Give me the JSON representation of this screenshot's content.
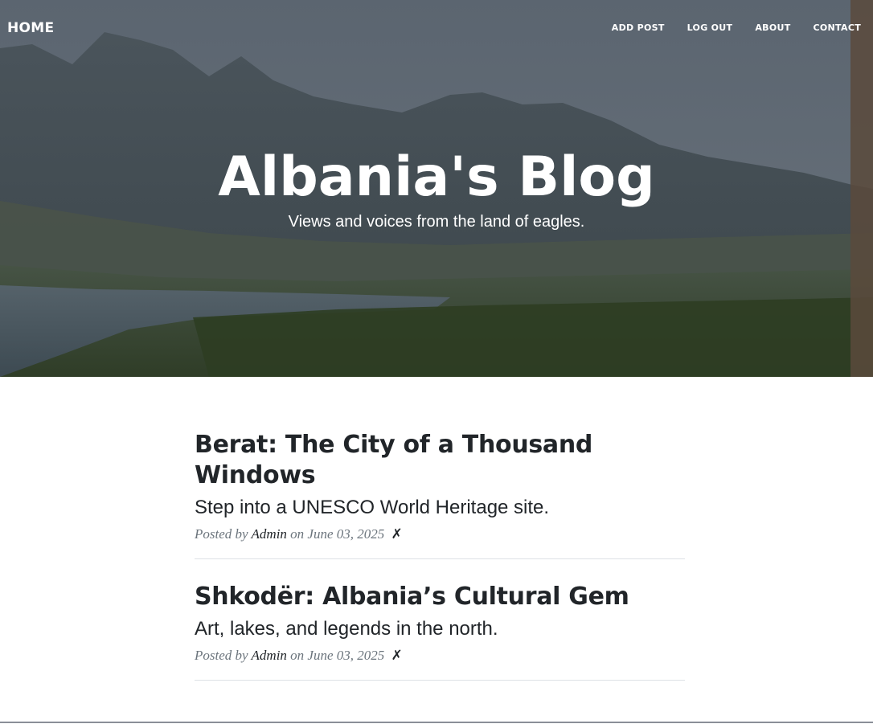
{
  "navbar": {
    "brand": "HOME",
    "links": [
      "ADD POST",
      "LOG OUT",
      "ABOUT",
      "CONTACT"
    ]
  },
  "header": {
    "title": "Albania's Blog",
    "subtitle": "Views and voices from the land of eagles."
  },
  "posts": [
    {
      "title": "Berat: The City of a Thousand Windows",
      "subtitle": "Step into a UNESCO World Heritage site.",
      "meta_prefix": "Posted by",
      "author": "Admin",
      "date_text": "on June 03, 2025",
      "delete_symbol": "✗"
    },
    {
      "title": "Shkodër: Albania’s Cultural Gem",
      "subtitle": "Art, lakes, and legends in the north.",
      "meta_prefix": "Posted by",
      "author": "Admin",
      "date_text": "on June 03, 2025",
      "delete_symbol": "✗"
    }
  ]
}
